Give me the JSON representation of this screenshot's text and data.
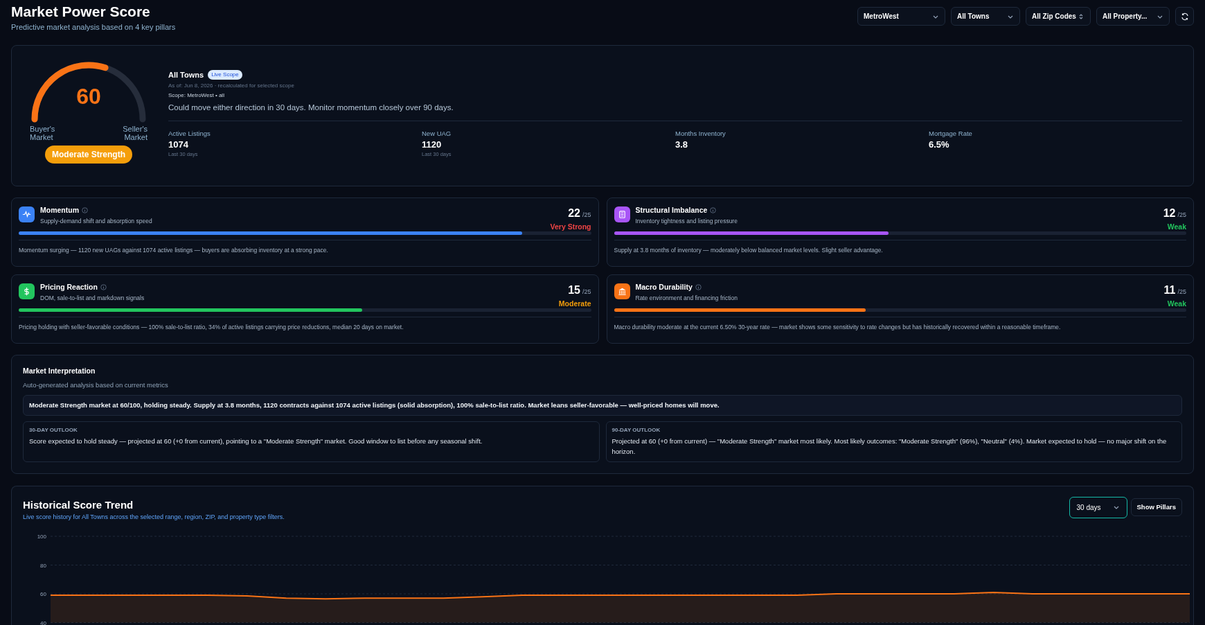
{
  "header": {
    "title": "Market Power Score",
    "subtitle": "Predictive market analysis based on 4 key pillars"
  },
  "filters": [
    {
      "label": "MetroWest",
      "kind": "dropdown"
    },
    {
      "label": "All Towns",
      "kind": "dropdown"
    },
    {
      "label": "All Zip Codes",
      "kind": "stepper"
    },
    {
      "label": "All Property...",
      "kind": "dropdown"
    }
  ],
  "score": {
    "value": "60",
    "level": 0.6,
    "left_label": "Buyer's Market",
    "right_label": "Seller's Market",
    "badge": "Moderate Strength",
    "scope_title": "All Towns",
    "scope_badge": "Live Scope",
    "as_of": "As of: Jun 8, 2026 · recalculated for selected scope",
    "scope": "Scope: MetroWest • all",
    "summary": "Could move either direction in 30 days. Monitor momentum closely over 90 days.",
    "stats": [
      {
        "label": "Active Listings",
        "value": "1074",
        "note": "Last 30 days"
      },
      {
        "label": "New UAG",
        "value": "1120",
        "note": "Last 30 days"
      },
      {
        "label": "Months Inventory",
        "value": "3.8"
      },
      {
        "label": "Mortgage Rate",
        "value": "6.5%"
      }
    ]
  },
  "pillars": [
    {
      "name": "Momentum",
      "kind": "pulse",
      "color": "#3b82f6",
      "description": "Supply-demand shift and absorption speed",
      "score": "22",
      "max": "/25",
      "rating": {
        "text": "Very Strong",
        "color": "#ef4444"
      },
      "level": 0.88,
      "note": "Momentum surging — 1120 new UAGs against 1074 active listings — buyers are absorbing inventory at a strong pace."
    },
    {
      "name": "Structural Imbalance",
      "kind": "building",
      "color": "#a855f7",
      "description": "Inventory tightness and listing pressure",
      "score": "12",
      "max": "/25",
      "rating": {
        "text": "Weak",
        "color": "#22c55e"
      },
      "level": 0.48,
      "note": "Supply at 3.8 months of inventory — moderately below balanced market levels. Slight seller advantage."
    },
    {
      "name": "Pricing Reaction",
      "kind": "dollar",
      "color": "#22c55e",
      "description": "DOM, sale-to-list and markdown signals",
      "score": "15",
      "max": "/25",
      "rating": {
        "text": "Moderate",
        "color": "#f59e0b"
      },
      "level": 0.6,
      "note": "Pricing holding with seller-favorable conditions — 100% sale-to-list ratio, 34% of active listings carrying price reductions, median 20 days on market."
    },
    {
      "name": "Macro Durability",
      "kind": "bank",
      "color": "#f97316",
      "description": "Rate environment and financing friction",
      "score": "11",
      "max": "/25",
      "rating": {
        "text": "Weak",
        "color": "#22c55e"
      },
      "level": 0.44,
      "note": "Macro durability moderate at the current 6.50% 30-year rate — market shows some sensitivity to rate changes but has historically recovered within a reasonable timeframe."
    }
  ],
  "interpretation": {
    "title": "Market Interpretation",
    "subtitle": "Auto-generated analysis based on current metrics",
    "summary": "Moderate Strength market at 60/100, holding steady. Supply at 3.8 months, 1120 contracts against 1074 active listings (solid absorption), 100% sale-to-list ratio. Market leans seller-favorable — well-priced homes will move.",
    "outlooks": [
      {
        "label": "30-DAY OUTLOOK",
        "text": "Score expected to hold steady — projected at 60 (+0 from current), pointing to a \"Moderate Strength\" market. Good window to list before any seasonal shift."
      },
      {
        "label": "90-DAY OUTLOOK",
        "text": "Projected at 60 (+0 from current) — \"Moderate Strength\" market most likely. Most likely outcomes: \"Moderate Strength\" (96%), \"Neutral\" (4%). Market expected to hold — no major shift on the horizon."
      }
    ]
  },
  "trend": {
    "title": "Historical Score Trend",
    "subtitle": "Live score history for All Towns across the selected range, region, ZIP, and property type filters.",
    "range": "30 days",
    "pillars_button": "Show Pillars",
    "chart_data": {
      "type": "area",
      "ylim": [
        40,
        100
      ],
      "yticks": [
        40,
        60,
        80,
        100
      ],
      "series": [
        {
          "color": "#f97316",
          "values": [
            59,
            59,
            59,
            59,
            59,
            58.5,
            57,
            56.5,
            57,
            57,
            57,
            58,
            59,
            59,
            59,
            59,
            59,
            59,
            59,
            59,
            60,
            60,
            60,
            60,
            61,
            60,
            60,
            60,
            60,
            60
          ]
        }
      ]
    }
  }
}
